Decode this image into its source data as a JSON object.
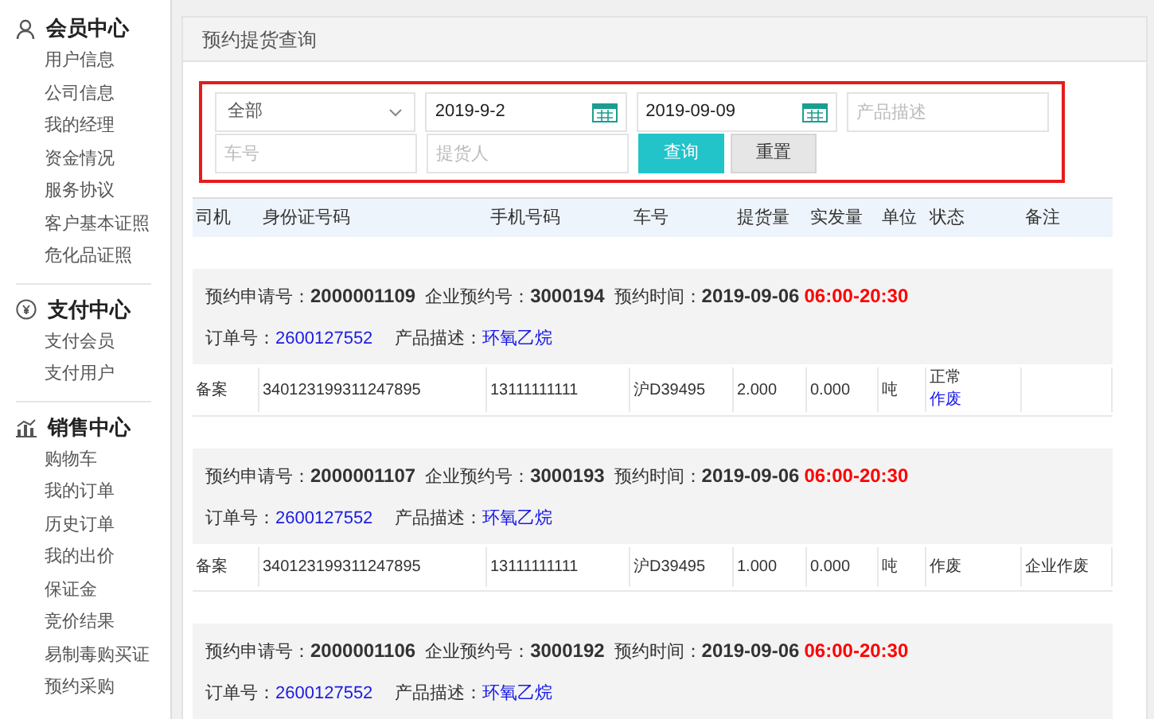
{
  "sidebar": {
    "sections": [
      {
        "title": "会员中心",
        "items": [
          "用户信息",
          "公司信息",
          "我的经理",
          "资金情况",
          "服务协议",
          "客户基本证照",
          "危化品证照"
        ]
      },
      {
        "title": "支付中心",
        "items": [
          "支付会员",
          "支付用户"
        ]
      },
      {
        "title": "销售中心",
        "items": [
          "购物车",
          "我的订单",
          "历史订单",
          "我的出价",
          "保证金",
          "竞价结果",
          "易制毒购买证",
          "预约采购"
        ]
      }
    ]
  },
  "page_title": "预约提货查询",
  "filters": {
    "category": {
      "value": "全部"
    },
    "date_from": {
      "value": "2019-9-2"
    },
    "date_to": {
      "value": "2019-09-09"
    },
    "product": {
      "placeholder": "产品描述"
    },
    "vehicle": {
      "placeholder": "车号"
    },
    "receiver": {
      "placeholder": "提货人"
    },
    "search_button": "查询",
    "reset_button": "重置"
  },
  "table": {
    "columns": [
      "司机",
      "身份证号码",
      "手机号码",
      "车号",
      "提货量",
      "实发量",
      "单位",
      "状态",
      "备注"
    ],
    "groups": [
      {
        "request": {
          "label": "预约申请号：",
          "value": "2000001109"
        },
        "company": {
          "label": "企业预约号：",
          "value": "3000194"
        },
        "time": {
          "label": "预约时间：",
          "date": "2019-09-06",
          "slot": "06:00-20:30"
        },
        "order": {
          "label": "订单号：",
          "value": "2600127552"
        },
        "product": {
          "label": "产品描述：",
          "value": "环氧乙烷"
        },
        "rows": [
          {
            "driver": "备案",
            "id_number": "340123199311247895",
            "phone": "13111111111",
            "plate": "沪D39495",
            "planned": "2.000",
            "shipped": "0.000",
            "unit": "吨",
            "status": "正常",
            "action": "作废"
          }
        ]
      },
      {
        "request": {
          "label": "预约申请号：",
          "value": "2000001107"
        },
        "company": {
          "label": "企业预约号：",
          "value": "3000193"
        },
        "time": {
          "label": "预约时间：",
          "date": "2019-09-06",
          "slot": "06:00-20:30"
        },
        "order": {
          "label": "订单号：",
          "value": "2600127552"
        },
        "product": {
          "label": "产品描述：",
          "value": "环氧乙烷"
        },
        "rows": [
          {
            "driver": "备案",
            "id_number": "340123199311247895",
            "phone": "13111111111",
            "plate": "沪D39495",
            "planned": "1.000",
            "shipped": "0.000",
            "unit": "吨",
            "status": "作废",
            "remark": "企业作废"
          }
        ]
      },
      {
        "request": {
          "label": "预约申请号：",
          "value": "2000001106"
        },
        "company": {
          "label": "企业预约号：",
          "value": "3000192"
        },
        "time": {
          "label": "预约时间：",
          "date": "2019-09-06",
          "slot": "06:00-20:30"
        },
        "order": {
          "label": "订单号：",
          "value": "2600127552"
        },
        "product": {
          "label": "产品描述：",
          "value": "环氧乙烷"
        }
      }
    ]
  }
}
